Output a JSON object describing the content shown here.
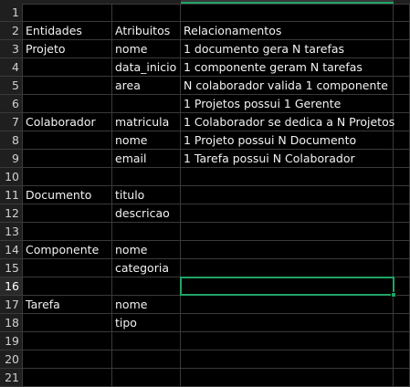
{
  "sheet": {
    "accent_color": "#21a366",
    "selected_cell": "C16",
    "rows": [
      {
        "num": "1",
        "a": "",
        "b": "",
        "c": ""
      },
      {
        "num": "2",
        "a": "Entidades",
        "b": "Atribuitos",
        "c": "Relacionamentos"
      },
      {
        "num": "3",
        "a": "Projeto",
        "b": "nome",
        "c": "1 documento gera N tarefas"
      },
      {
        "num": "4",
        "a": "",
        "b": "data_inicio",
        "c": "1 componente geram N tarefas"
      },
      {
        "num": "5",
        "a": "",
        "b": "area",
        "c": "N colaborador valida 1 componente"
      },
      {
        "num": "6",
        "a": "",
        "b": "",
        "c": "1 Projetos possui 1 Gerente"
      },
      {
        "num": "7",
        "a": "Colaborador",
        "b": "matricula",
        "c": "1 Colaborador se dedica a N Projetos"
      },
      {
        "num": "8",
        "a": "",
        "b": "nome",
        "c": "1 Projeto possui N Documento"
      },
      {
        "num": "9",
        "a": "",
        "b": "email",
        "c": "1 Tarefa possui N Colaborador"
      },
      {
        "num": "10",
        "a": "",
        "b": "",
        "c": ""
      },
      {
        "num": "11",
        "a": "Documento",
        "b": "titulo",
        "c": ""
      },
      {
        "num": "12",
        "a": "",
        "b": "descricao",
        "c": ""
      },
      {
        "num": "13",
        "a": "",
        "b": "",
        "c": ""
      },
      {
        "num": "14",
        "a": "Componente",
        "b": "nome",
        "c": ""
      },
      {
        "num": "15",
        "a": "",
        "b": "categoria",
        "c": ""
      },
      {
        "num": "16",
        "a": "",
        "b": "",
        "c": ""
      },
      {
        "num": "17",
        "a": "Tarefa",
        "b": "nome",
        "c": ""
      },
      {
        "num": "18",
        "a": "",
        "b": "tipo",
        "c": ""
      },
      {
        "num": "19",
        "a": "",
        "b": "",
        "c": ""
      },
      {
        "num": "20",
        "a": "",
        "b": "",
        "c": ""
      },
      {
        "num": "21",
        "a": "",
        "b": "",
        "c": ""
      }
    ]
  }
}
